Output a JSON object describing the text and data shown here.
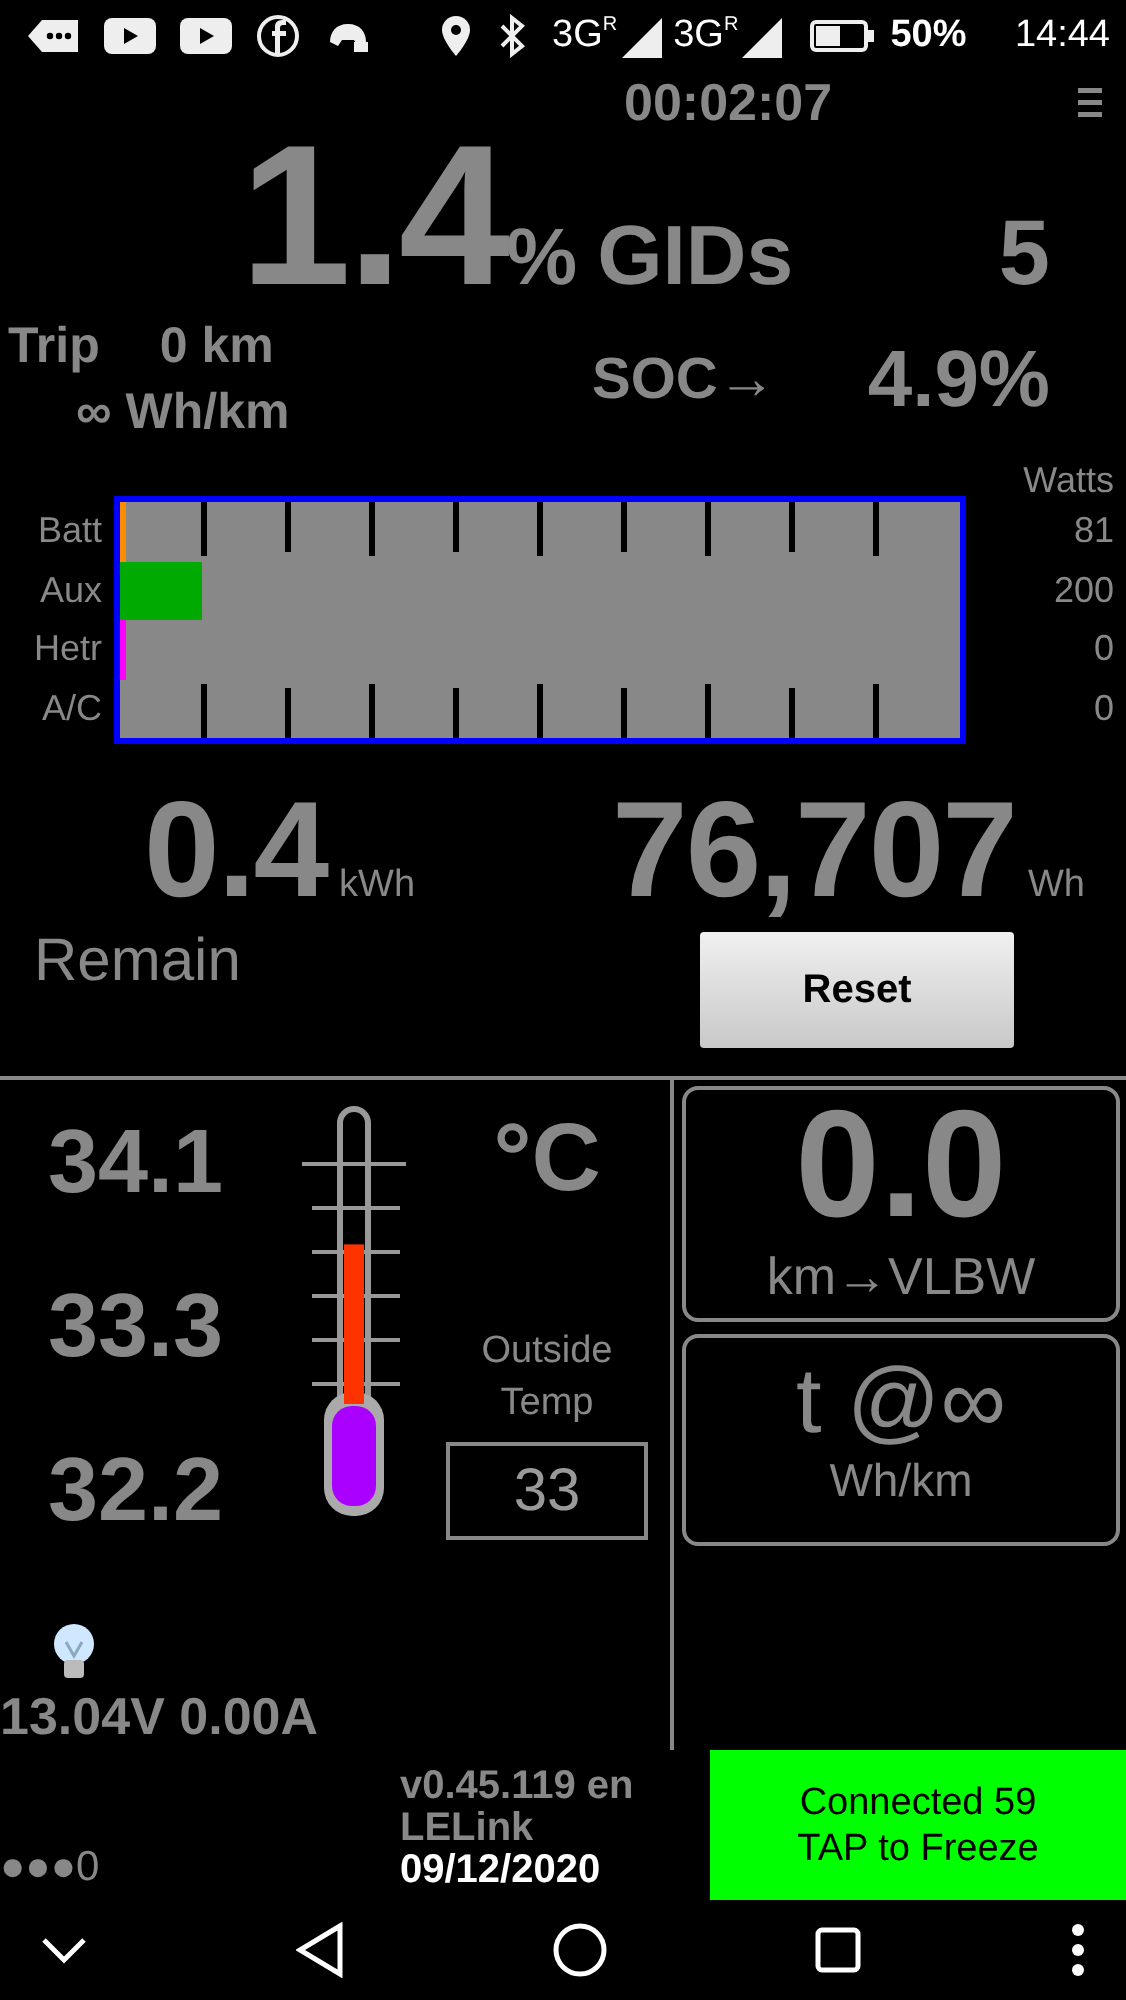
{
  "status_bar": {
    "signals": [
      {
        "network": "3G",
        "roaming": "R"
      },
      {
        "network": "3G",
        "roaming": "R"
      }
    ],
    "battery_percent": "50%",
    "time": "14:44"
  },
  "header": {
    "timer": "00:02:07",
    "charge": "1.4",
    "percent_sign": "%",
    "gids_label": "GIDs",
    "gids": "5"
  },
  "trip": {
    "label": "Trip",
    "distance": "0 km",
    "consumption": "∞ Wh/km",
    "soc_label": "SOC→",
    "soc": "4.9%"
  },
  "power": {
    "header": "Watts",
    "channels": [
      {
        "name": "Batt",
        "watts": "81",
        "level": 0.006,
        "color": "#ff8c00"
      },
      {
        "name": "Aux",
        "watts": "200",
        "level": 0.098,
        "color": "#00aa00"
      },
      {
        "name": "Hetr",
        "watts": "0",
        "level": 0.006,
        "color": "#ff00ff"
      },
      {
        "name": "A/C",
        "watts": "0"
      }
    ]
  },
  "energy": {
    "remain": "0.4",
    "remain_unit": "kWh",
    "remain_label": "Remain",
    "total": "76,707",
    "total_unit": "Wh",
    "reset_button": "Reset"
  },
  "temperatures": {
    "readings": [
      "34.1",
      "33.3",
      "32.2"
    ],
    "thermometer": {
      "level": 0.6
    },
    "unit": "°C",
    "outside_label": "Outside Temp",
    "outside_value": "33"
  },
  "aux_battery": {
    "reading": "13.04V 0.00A"
  },
  "range_box": {
    "value": "0.0",
    "label": "km→VLBW"
  },
  "efficiency_box": {
    "value": "t @∞",
    "label": "Wh/km"
  },
  "footer": {
    "indicator": "●●●0",
    "version": "v0.45.119 en",
    "adapter": "LELink",
    "date": "09/12/2020",
    "connect_button": [
      "Connected 59",
      "TAP to Freeze"
    ]
  }
}
